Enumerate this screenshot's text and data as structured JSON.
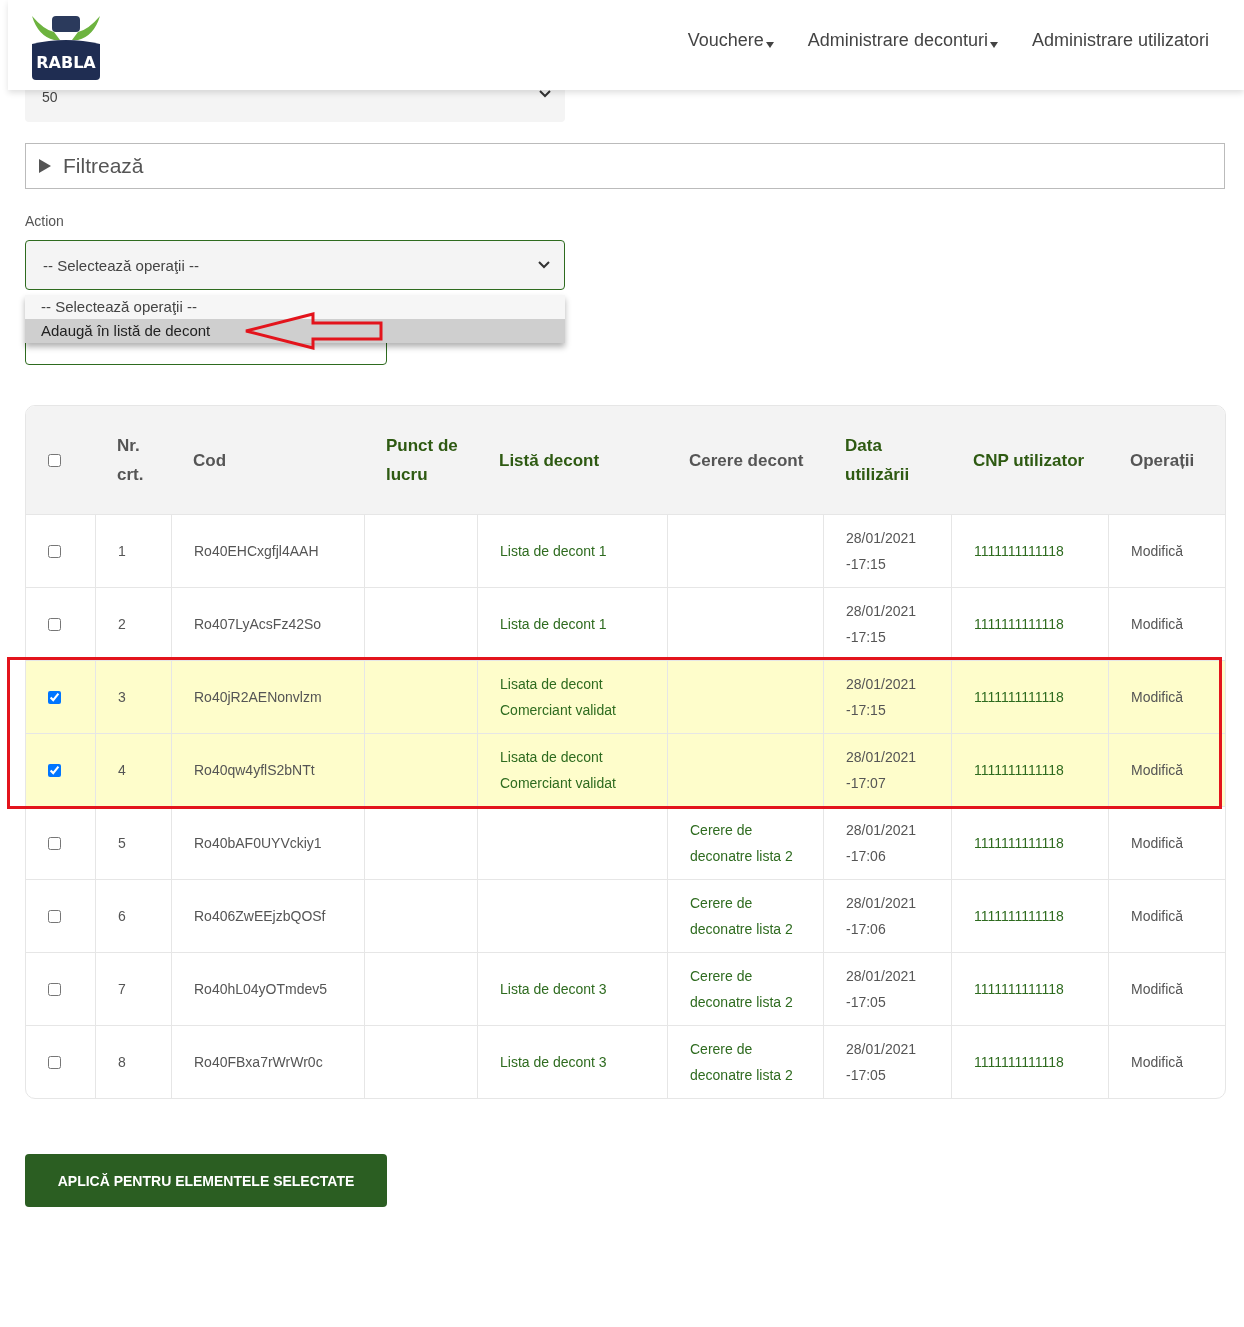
{
  "header": {
    "logo_text": "RABLA",
    "nav": [
      {
        "label": "Vouchere",
        "has_menu": true
      },
      {
        "label": "Administrare deconturi",
        "has_menu": true
      },
      {
        "label": "Administrare utilizatori",
        "has_menu": false
      }
    ]
  },
  "page_size": {
    "value": "50"
  },
  "filter": {
    "label": "Filtrează",
    "expanded": false
  },
  "action": {
    "label": "Action",
    "value": "-- Selectează operaţii --",
    "open": true,
    "options": [
      {
        "label": "-- Selectează operaţii --",
        "highlighted": false
      },
      {
        "label": "Adaugă în listă de decont",
        "highlighted": true
      }
    ]
  },
  "table": {
    "columns": [
      {
        "label": "Nr. crt.",
        "kind": "text",
        "sortable": false
      },
      {
        "label": "Cod",
        "kind": "text",
        "sortable": false
      },
      {
        "label": "Punct de lucru",
        "kind": "text",
        "sortable": true
      },
      {
        "label": "Listă decont",
        "kind": "link",
        "sortable": true
      },
      {
        "label": "Cerere decont",
        "kind": "link",
        "sortable": false
      },
      {
        "label": "Data utilizării",
        "kind": "text",
        "sortable": true
      },
      {
        "label": "CNP utilizator",
        "kind": "link",
        "sortable": true
      },
      {
        "label": "Operații",
        "kind": "action",
        "sortable": false
      }
    ],
    "all_checked": false,
    "rows": [
      {
        "selected": false,
        "cells": [
          "1",
          "Ro40EHCxgfjl4AAH",
          "",
          "Lista de decont 1",
          "",
          "28/01/2021 -17:15",
          "1111111111118",
          "Modifică"
        ]
      },
      {
        "selected": false,
        "cells": [
          "2",
          "Ro407LyAcsFz42So",
          "",
          "Lista de decont 1",
          "",
          "28/01/2021 -17:15",
          "1111111111118",
          "Modifică"
        ]
      },
      {
        "selected": true,
        "cells": [
          "3",
          "Ro40jR2AENonvlzm",
          "",
          "Lisata de decont Comerciant validat",
          "",
          "28/01/2021 -17:15",
          "1111111111118",
          "Modifică"
        ]
      },
      {
        "selected": true,
        "cells": [
          "4",
          "Ro40qw4yflS2bNTt",
          "",
          "Lisata de decont Comerciant validat",
          "",
          "28/01/2021 -17:07",
          "1111111111118",
          "Modifică"
        ]
      },
      {
        "selected": false,
        "cells": [
          "5",
          "Ro40bAF0UYVckiy1",
          "",
          "",
          "Cerere de deconatre lista 2",
          "28/01/2021 -17:06",
          "1111111111118",
          "Modifică"
        ]
      },
      {
        "selected": false,
        "cells": [
          "6",
          "Ro406ZwEEjzbQOSf",
          "",
          "",
          "Cerere de deconatre lista 2",
          "28/01/2021 -17:06",
          "1111111111118",
          "Modifică"
        ]
      },
      {
        "selected": false,
        "cells": [
          "7",
          "Ro40hL04yOTmdev5",
          "",
          "Lista de decont 3",
          "Cerere de deconatre lista 2",
          "28/01/2021 -17:05",
          "1111111111118",
          "Modifică"
        ]
      },
      {
        "selected": false,
        "cells": [
          "8",
          "Ro40FBxa7rWrWr0c",
          "",
          "Lista de decont 3",
          "Cerere de deconatre lista 2",
          "28/01/2021 -17:05",
          "1111111111118",
          "Modifică"
        ]
      }
    ]
  },
  "apply_button": {
    "label": "APLICĂ PENTRU ELEMENTELE SELECTATE"
  }
}
